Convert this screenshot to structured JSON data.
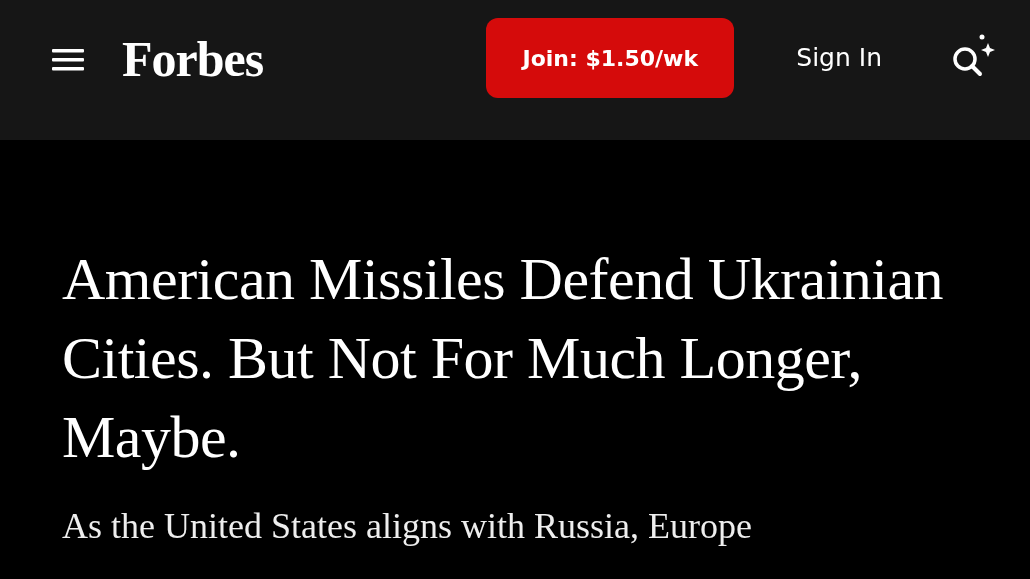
{
  "header": {
    "logo": "Forbes",
    "join_button": "Join: $1.50/wk",
    "sign_in": "Sign In"
  },
  "article": {
    "headline": "American Missiles Defend Ukrainian Cities. But Not For Much Longer, Maybe.",
    "dek": "As the United States aligns with Russia, Europe"
  }
}
